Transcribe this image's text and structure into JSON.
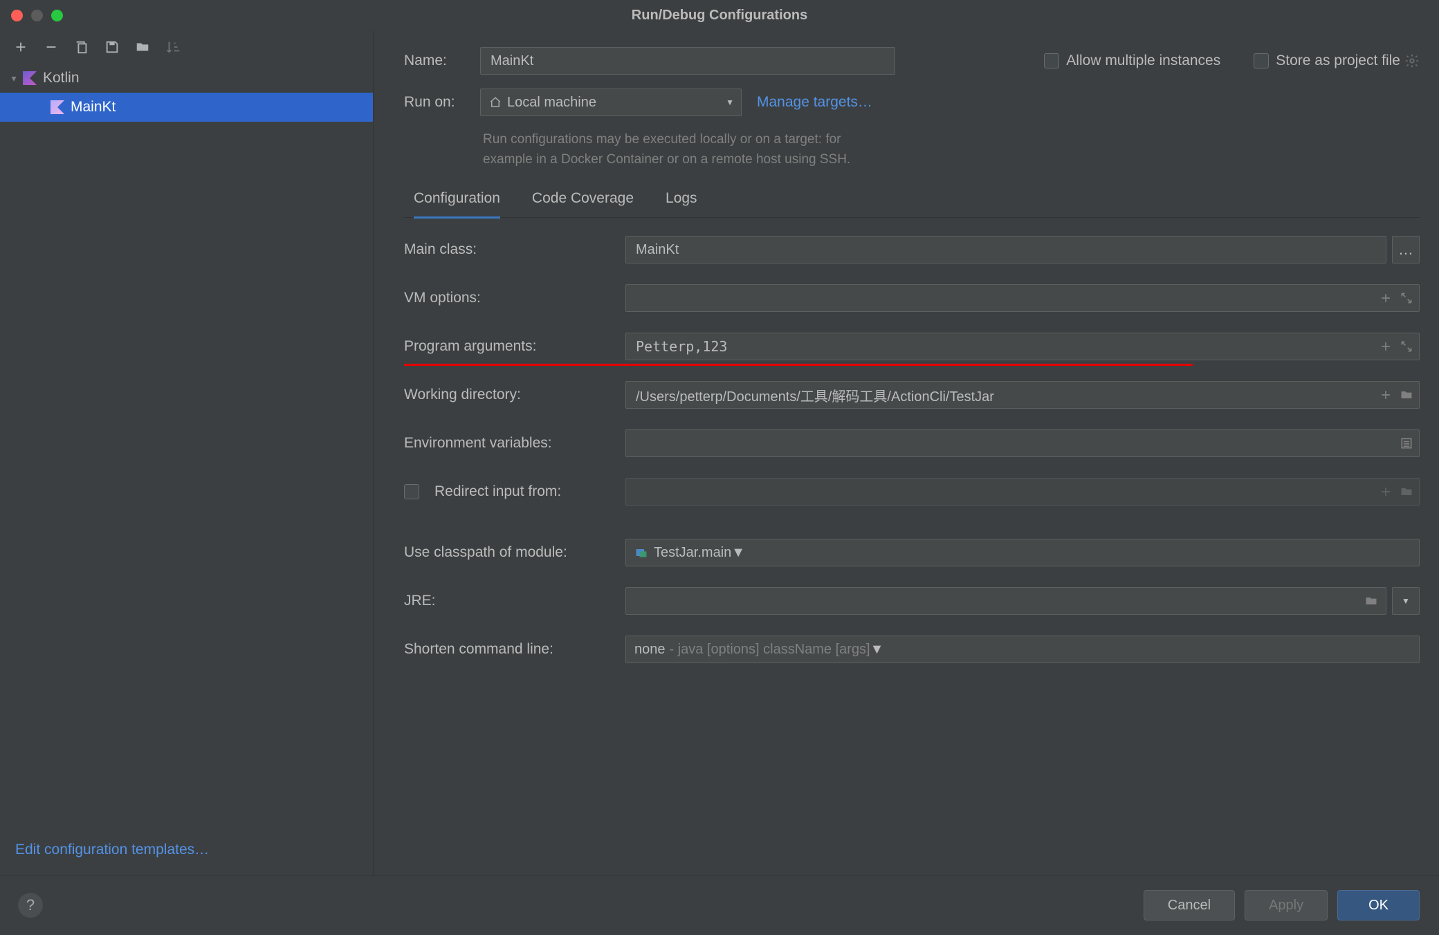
{
  "title": "Run/Debug Configurations",
  "sidebar": {
    "group_label": "Kotlin",
    "items": [
      "MainKt"
    ],
    "templates_link": "Edit configuration templates…"
  },
  "form": {
    "name_label": "Name:",
    "name_value": "MainKt",
    "allow_multiple": "Allow multiple instances",
    "store_as_project": "Store as project file",
    "run_on_label": "Run on:",
    "run_on_value": "Local machine",
    "manage_targets": "Manage targets…",
    "hint_line1": "Run configurations may be executed locally or on a target: for",
    "hint_line2": "example in a Docker Container or on a remote host using SSH."
  },
  "tabs": {
    "configuration": "Configuration",
    "coverage": "Code Coverage",
    "logs": "Logs"
  },
  "fields": {
    "main_class_label": "Main class:",
    "main_class_value": "MainKt",
    "vm_options_label": "VM options:",
    "vm_options_value": "",
    "program_args_label": "Program arguments:",
    "program_args_value": "Petterp,123",
    "working_dir_label": "Working directory:",
    "working_dir_value": "/Users/petterp/Documents/工具/解码工具/ActionCli/TestJar",
    "env_vars_label": "Environment variables:",
    "env_vars_value": "",
    "redirect_label": "Redirect input from:",
    "redirect_value": "",
    "classpath_label": "Use classpath of module:",
    "classpath_value": "TestJar.main",
    "jre_label": "JRE:",
    "jre_value": "",
    "shorten_label": "Shorten command line:",
    "shorten_value": "none",
    "shorten_hint": "- java [options] className [args]"
  },
  "buttons": {
    "cancel": "Cancel",
    "apply": "Apply",
    "ok": "OK",
    "help": "?",
    "ellipsis": "…"
  }
}
